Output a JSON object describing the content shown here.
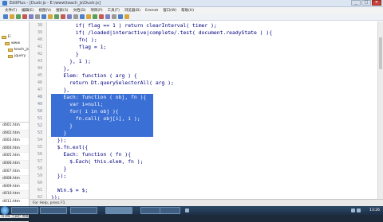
{
  "window": {
    "title": "EditPlus - [Dustr.js - E:\\www\\teach_js\\Dustr.js]",
    "controls": [
      "_",
      "□",
      "✕"
    ]
  },
  "menu": [
    "文件(F)",
    "编辑(E)",
    "视图(V)",
    "搜索(S)",
    "文档(D)",
    "项目(P)",
    "工具(T)",
    "浏览器(B)",
    "Emmet",
    "窗口(W)",
    "帮助(H)"
  ],
  "toolbar_colors": [
    "#4f7fc4",
    "#d7a73b",
    "#5aa05a",
    "#c45a4f",
    "#7f7fc4",
    "#999999",
    "#4f7fc4",
    "#d7a73b",
    "#5aa05a",
    "#c45a4f",
    "#7f7fc4",
    "#999999",
    "#4f7fc4",
    "#d7a73b",
    "#5aa05a",
    "#c45a4f",
    "#7f7fc4",
    "#999999",
    "#4f7fc4",
    "#d7a73b"
  ],
  "sidebar": {
    "tree": [
      "E:",
      "www",
      "teach_js",
      "jquery"
    ],
    "files": [
      "d001.htm",
      "d002.htm",
      "d003.htm",
      "d004.htm",
      "d005.htm",
      "d006.htm",
      "d007.htm",
      "d008.htm",
      "d009.htm",
      "d010.htm",
      "d011.htm",
      "d012.htm",
      "d013.htm"
    ],
    "tabs": "HTML 工具栏  剪辑"
  },
  "editor": {
    "lines": [
      {
        "n": "38",
        "indent": 8,
        "text": "if( flag == 1 ) return clearInterval( timer );"
      },
      {
        "n": "39",
        "indent": 8,
        "text": "if( /loaded|interactive|complete/.test( document.readyState ) ){"
      },
      {
        "n": "40",
        "indent": 9,
        "text": "fn( );"
      },
      {
        "n": "41",
        "indent": 9,
        "text": "flag = 1;"
      },
      {
        "n": "42",
        "indent": 8,
        "text": "}"
      },
      {
        "n": "43",
        "indent": 6,
        "text": "}, 1 );"
      },
      {
        "n": "44",
        "indent": 4,
        "text": "},"
      },
      {
        "n": "45",
        "indent": 4,
        "text": "Elem: function ( arg ) {"
      },
      {
        "n": "46",
        "indent": 6,
        "text": "return Dt.querySelectorAll( arg );"
      },
      {
        "n": "47",
        "indent": 4,
        "text": "},"
      },
      {
        "n": "48",
        "indent": 4,
        "text": "Each: function ( obj, fn ){"
      },
      {
        "n": "49",
        "indent": 6,
        "text": "var i=null;"
      },
      {
        "n": "50",
        "indent": 6,
        "text": "for( i in obj ){"
      },
      {
        "n": "51",
        "indent": 8,
        "text": "fn.call( obj[i], i );"
      },
      {
        "n": "52",
        "indent": 6,
        "text": "}"
      },
      {
        "n": "53",
        "indent": 4,
        "text": "}"
      },
      {
        "n": "54",
        "indent": 2,
        "text": "});"
      },
      {
        "n": "55",
        "indent": 2,
        "text": "$.fn.ext({"
      },
      {
        "n": "56",
        "indent": 4,
        "text": "Each: function ( fn ){"
      },
      {
        "n": "57",
        "indent": 6,
        "text": "$.Each( this.elem, fn );"
      },
      {
        "n": "58",
        "indent": 4,
        "text": "}"
      },
      {
        "n": "59",
        "indent": 2,
        "text": "});"
      },
      {
        "n": "60",
        "indent": 2,
        "text": ""
      },
      {
        "n": "61",
        "indent": 2,
        "text": "Win.$ = $;"
      },
      {
        "n": "62",
        "indent": 0,
        "text": "});"
      }
    ],
    "selected_from": 10,
    "selected_to": 15,
    "selection_color": "#3a6fd6",
    "code_color": "#000080"
  },
  "statusbar": "For Help, press F1",
  "taskbar": {
    "items": [
      "",
      "",
      "",
      "",
      "",
      ""
    ],
    "clock": "13:26"
  }
}
